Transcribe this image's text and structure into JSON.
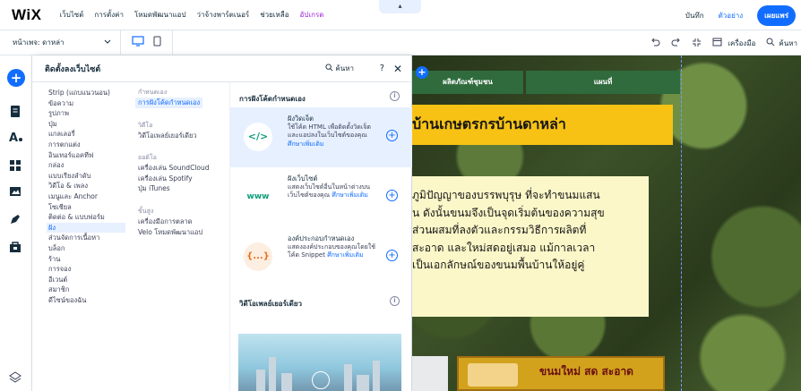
{
  "topbar": {
    "logo": "WiX",
    "menu": [
      "เว็บไซต์",
      "การตั้งค่า",
      "โหมดพัฒนาแอป",
      "ว่าจ้างพาร์ตเนอร์",
      "ช่วยเหลือ",
      "อัปเกรด"
    ],
    "collapse_arrow": "▴",
    "save": "บันทึก",
    "preview": "ตัวอย่าง",
    "publish": "เผยแพร่"
  },
  "toolbar2": {
    "page_label": "หน้าเพจ: ดาหล่า",
    "tools_label": "เครื่องมือ",
    "search_label": "ค้นหา"
  },
  "panel": {
    "title": "ติดตั้งลงเว็บไซต์",
    "search": "ค้นหา",
    "help": "?",
    "close": "✕",
    "categories": [
      "Strip (แถบแนวนอน)",
      "ข้อความ",
      "รูปภาพ",
      "ปุ่ม",
      "แกลเลอรี่",
      "การตกแต่ง",
      "อินเทอร์แอคทีฟ",
      "กล่อง",
      "แบบเรียงลำดับ",
      "วิดีโอ & เพลง",
      "เมนูและ Anchor",
      "โซเชียล",
      "ติดต่อ & แบบฟอร์ม",
      "ฝัง",
      "ส่วนจัดการเนื้อหา",
      "บล็อก",
      "ร้าน",
      "การจอง",
      "อีเวนต์",
      "สมาชิก",
      "ดีไซน์ของฉัน"
    ],
    "active_category_index": 13,
    "groups": [
      {
        "heading": "กำหนดเอง",
        "items": [
          "การฝังโค้ดกำหนดเอง"
        ]
      },
      {
        "heading": "วิดีโอ",
        "items": [
          "วิดีโอเพลย์เยอร์เดียว"
        ]
      },
      {
        "heading": "ออดิโอ",
        "items": [
          "เครื่องเล่น SoundCloud",
          "เครื่องเล่น Spotify",
          "ปุ่ม iTunes"
        ]
      },
      {
        "heading": "ขั้นสูง",
        "items": [
          "เครื่องมือการตลาด",
          "Velo โหมดพัฒนาแอป"
        ]
      }
    ],
    "section_title": "การฝังโค้ดกำหนดเอง",
    "cards": [
      {
        "icon": "</>",
        "icon_color": "#0f9d7a",
        "title": "ฝังวิดเจ็ต",
        "desc": "ใช้โค้ด HTML เพื่อติดตั้งวิดเจ็ตและแอปลงในเว็บไซต์ของคุณ",
        "link": "ศึกษาเพิ่มเติม"
      },
      {
        "icon": "www",
        "icon_color": "#0f9d7a",
        "title": "ฝังเว็บไซต์",
        "desc": "แสดงเว็บไซต์อื่นในหน้าต่างบนเว็บไซต์ของคุณ",
        "link": "ศึกษาเพิ่มเติม"
      },
      {
        "icon": "{...}",
        "icon_color": "#e8721c",
        "title": "องค์ประกอบกำหนดเอง",
        "desc": "แสดงองค์ประกอบของคุณโดยใช้โค้ด Snippet",
        "link": "ศึกษาเพิ่มเติม"
      }
    ],
    "video_section_title": "วิดีโอเพลย์เยอร์เดียว"
  },
  "site": {
    "nav": [
      "ผลิตภัณฑ์ชุมชน",
      "แผนที่"
    ],
    "banner_title": "บ้านเกษตรกรบ้านดาหล่า",
    "body_lines": [
      "ภูมิปัญญาของบรรพบุรุษ ที่จะทำขนมแสน",
      "น ดังนั้นขนมจึงเป็นจุดเริ่มต้นของความสุข",
      "ส่วนผสมที่ลงตัวและกรรมวิธีการผลิตที่",
      "สะอาด และใหม่สดอยู่เสมอ แม้กาลเวลา",
      "เป็นเอกลักษณ์ของขนมพื้นบ้านให้อยู่คู่"
    ],
    "ad_text": "ขนมใหม่ สด สะอาด"
  },
  "colors": {
    "accent": "#116dff",
    "nav_green": "#2f6b3c",
    "banner_yellow": "#f7c214",
    "upgrade": "#9a27d5"
  }
}
